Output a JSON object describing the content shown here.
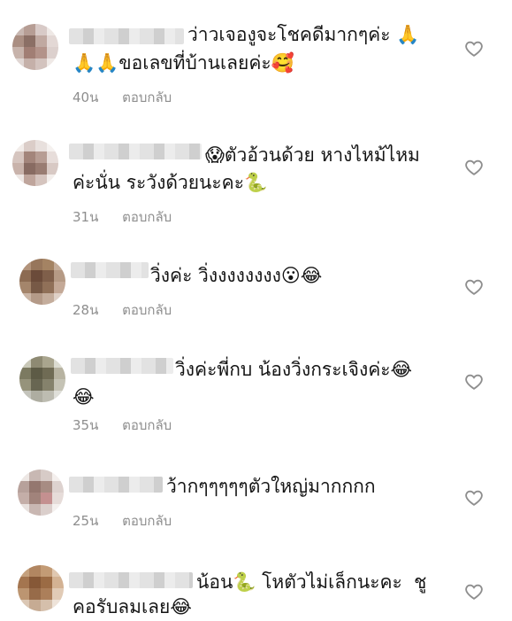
{
  "comments": [
    {
      "text_line1": "ว่าวเจองูจะโชคดีมากๆค่ะ 🙏",
      "text_line2": "🙏🙏ขอเลขที่บ้านเลยค่ะ🥰",
      "time": "40น",
      "reply": "ตอบกลับ"
    },
    {
      "text_line1": "😱ตัวอ้วนด้วย หางไหม้ไหม",
      "text_line2": "ค่ะนั่น ระวังด้วยนะคะ🐍",
      "time": "31น",
      "reply": "ตอบกลับ"
    },
    {
      "text_line1": "วิ่งค่ะ วิ่งงงงงงงง😮😂",
      "text_line2": "",
      "time": "28น",
      "reply": "ตอบกลับ"
    },
    {
      "text_line1": "วิ่งค่ะพี่กบ น้องวิ่งกระเจิงค่ะ😂",
      "text_line2": "😂",
      "time": "35น",
      "reply": "ตอบกลับ"
    },
    {
      "text_line1": "ว้ากๆๆๆๆๆตัวใหญ่มากกกก",
      "text_line2": "",
      "time": "25น",
      "reply": "ตอบกลับ"
    },
    {
      "text_line1": "น้อน🐍 โหตัวไม่เล็กนะคะ  ชู",
      "text_line2": "คอรับลมเลย😂",
      "time": "",
      "reply": ""
    }
  ],
  "icons": {
    "like": "heart-outline-icon"
  },
  "colors": {
    "text": "#151515",
    "meta": "#8e8e8e",
    "heart": "#8e8e8e"
  }
}
